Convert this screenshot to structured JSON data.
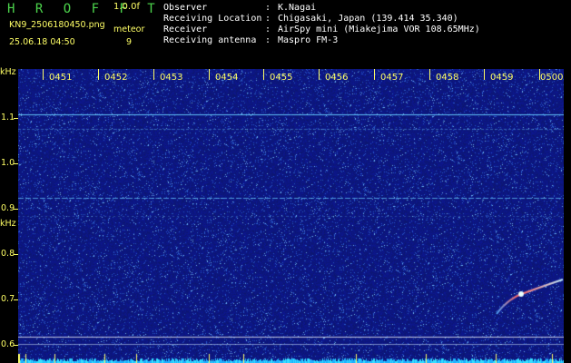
{
  "header": {
    "title": "H R O F F T",
    "version": "1.0.0f",
    "filename": "KN9_2506180450.png",
    "datetime": "25.06.18 04:50",
    "mode_label": "meteor",
    "mode_value": "9",
    "info": [
      {
        "label": "Observer",
        "sep": ":",
        "value": "K.Nagai"
      },
      {
        "label": "Receiving Location",
        "sep": ":",
        "value": "Chigasaki, Japan (139.414 35.340)"
      },
      {
        "label": "Receiver",
        "sep": ":",
        "value": "AirSpy mini (Miakejima VOR 108.65MHz)"
      },
      {
        "label": "Receiving antenna",
        "sep": ":",
        "value": "Maspro FM-3"
      }
    ]
  },
  "axes": {
    "y_unit": "kHz",
    "y_ticks": [
      "1.1",
      "1.0",
      "0.9",
      "0.8",
      "0.7",
      "0.6"
    ],
    "x_ticks": [
      "0451",
      "0452",
      "0453",
      "0454",
      "0455",
      "0456",
      "0457",
      "0458",
      "0459",
      "0500"
    ]
  },
  "colors": {
    "background": "#0d1a7a",
    "label": "#ffff66",
    "title": "#4cd44c",
    "carrier_line": "#66ccff"
  }
}
